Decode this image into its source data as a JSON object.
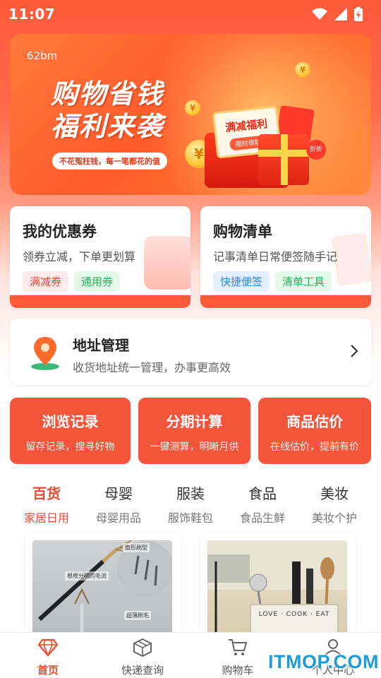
{
  "status_bar": {
    "time": "11:07"
  },
  "banner": {
    "tag": "62bm",
    "title_line1": "购物省钱",
    "title_line2": "福利来袭",
    "subtitle": "不花冤枉钱，每一笔都花的值",
    "ticket_title": "满减福利",
    "ticket_button": "限时领取",
    "badge": "折折",
    "coin_symbol": "¥"
  },
  "cards": {
    "coupon": {
      "title": "我的优惠券",
      "desc": "领券立减，下单更划算",
      "chips": [
        "满减券",
        "通用券"
      ]
    },
    "list": {
      "title": "购物清单",
      "desc": "记事清单日常便签随手记",
      "chips": [
        "快捷便签",
        "清单工具"
      ]
    }
  },
  "address": {
    "title": "地址管理",
    "desc": "收货地址统一管理，办事更高效"
  },
  "tools": [
    {
      "title": "浏览记录",
      "desc": "留存记录，搜寻好物"
    },
    {
      "title": "分期计算",
      "desc": "一键测算，明晰月供"
    },
    {
      "title": "商品估价",
      "desc": "在线估价，提前有价"
    }
  ],
  "categories": [
    {
      "name": "百货",
      "sub": "家居日用",
      "active": true
    },
    {
      "name": "母婴",
      "sub": "母婴用品",
      "active": false
    },
    {
      "name": "服装",
      "sub": "服饰鞋包",
      "active": false
    },
    {
      "name": "食品",
      "sub": "食品生鲜",
      "active": false
    },
    {
      "name": "美妆",
      "sub": "美妆个护",
      "active": false
    }
  ],
  "products": {
    "p1_labels": [
      "扇形刷型",
      "根根分明的毛流",
      "超薄刷毛"
    ],
    "p2_label": "LOVE · COOK · EAT"
  },
  "tabbar": [
    {
      "label": "首页",
      "icon": "diamond-icon",
      "active": true
    },
    {
      "label": "快递查询",
      "icon": "package-icon",
      "active": false
    },
    {
      "label": "购物车",
      "icon": "cart-icon",
      "active": false
    },
    {
      "label": "个人中心",
      "icon": "user-icon",
      "active": false
    }
  ],
  "watermark": "ITMOP.COM",
  "colors": {
    "accent": "#f5553a",
    "active_text": "#ee4a2e",
    "chip_red": "#e64a3a",
    "chip_green": "#2bb35a",
    "chip_blue": "#2f86e6"
  }
}
